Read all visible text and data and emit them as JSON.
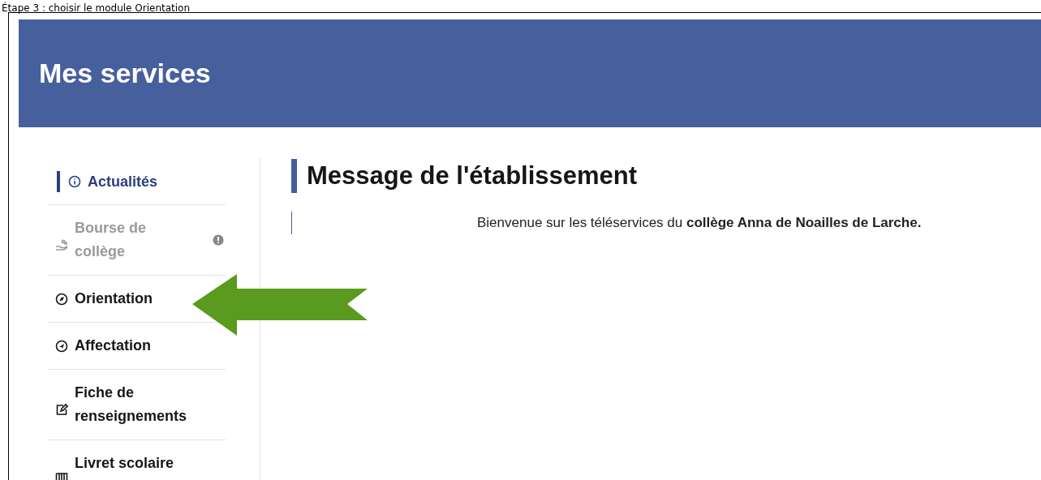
{
  "caption": "Étape 3 : choisir le module Orientation",
  "header": {
    "title": "Mes services"
  },
  "sidebar": {
    "items": [
      {
        "label": "Actualités",
        "selected": true,
        "disabled": false
      },
      {
        "label": "Bourse de collège",
        "selected": false,
        "disabled": true,
        "alert": true
      },
      {
        "label": "Orientation",
        "selected": false,
        "disabled": false
      },
      {
        "label": "Affectation",
        "selected": false,
        "disabled": false
      },
      {
        "label": "Fiche de renseignements",
        "selected": false,
        "disabled": false
      },
      {
        "label": "Livret scolaire",
        "selected": false,
        "disabled": false
      }
    ]
  },
  "main": {
    "heading": "Message de l'établissement",
    "message": "Bienvenue sur les téléservices du **collège Anna de Noailles de Larche.**"
  }
}
